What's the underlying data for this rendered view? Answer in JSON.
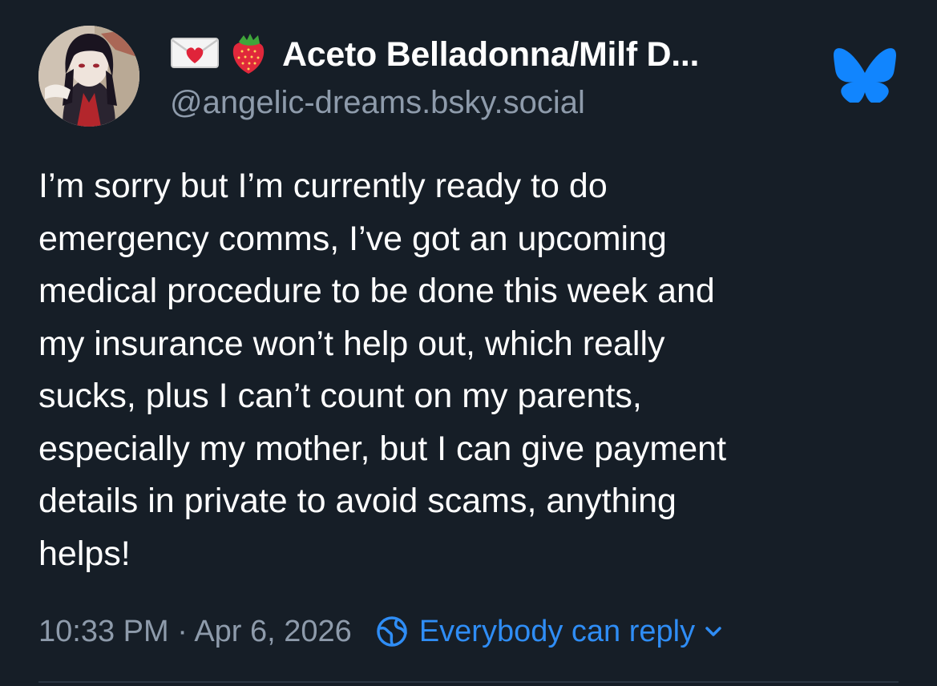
{
  "author": {
    "display_name": "Aceto Belladonna/Milf D...",
    "handle": "@angelic-dreams.bsky.social",
    "name_emojis": [
      "love-letter-icon",
      "strawberry-icon"
    ]
  },
  "post": {
    "lines": [
      "I’m sorry but I’m currently ready to do",
      "emergency comms, I’ve got an upcoming",
      "medical procedure to be done this week and",
      "my insurance won’t help out, which really",
      "sucks, plus I can’t count on my parents,",
      "especially my mother, but I can give payment",
      "details in private to avoid scams, anything",
      "helps!"
    ]
  },
  "meta": {
    "timestamp": "10:33 PM · Apr 6, 2026",
    "reply_setting": "Everybody can reply"
  },
  "colors": {
    "background": "#161e27",
    "text": "#ffffff",
    "muted": "#8e9bab",
    "accent": "#2f8df5",
    "bluesky_logo": "#1185fe"
  }
}
